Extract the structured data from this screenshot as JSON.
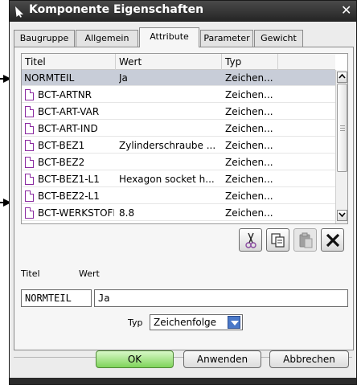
{
  "window": {
    "title": "Komponente Eigenschaften",
    "close_glyph": "✕"
  },
  "tabs": [
    {
      "label": "Baugruppe",
      "active": false
    },
    {
      "label": "Allgemein",
      "active": false
    },
    {
      "label": "Attribute",
      "active": true
    },
    {
      "label": "Parameter",
      "active": false
    },
    {
      "label": "Gewicht",
      "active": false
    }
  ],
  "table": {
    "columns": [
      "Titel",
      "Wert",
      "Typ"
    ],
    "rows": [
      {
        "titel": "NORMTEIL",
        "wert": "Ja",
        "typ": "Zeichen...",
        "selected": true,
        "icon": "none"
      },
      {
        "titel": "BCT-ARTNR",
        "wert": "",
        "typ": "Zeichen...",
        "selected": false,
        "icon": "document-icon"
      },
      {
        "titel": "BCT-ART-VAR",
        "wert": "",
        "typ": "Zeichen...",
        "selected": false,
        "icon": "document-icon"
      },
      {
        "titel": "BCT-ART-IND",
        "wert": "",
        "typ": "Zeichen...",
        "selected": false,
        "icon": "document-icon"
      },
      {
        "titel": "BCT-BEZ1",
        "wert": "Zylinderschraube ...",
        "typ": "Zeichen...",
        "selected": false,
        "icon": "document-icon"
      },
      {
        "titel": "BCT-BEZ2",
        "wert": "",
        "typ": "Zeichen...",
        "selected": false,
        "icon": "document-icon"
      },
      {
        "titel": "BCT-BEZ1-L1",
        "wert": "Hexagon socket h...",
        "typ": "Zeichen...",
        "selected": false,
        "icon": "document-icon"
      },
      {
        "titel": "BCT-BEZ2-L1",
        "wert": "",
        "typ": "Zeichen...",
        "selected": false,
        "icon": "document-icon"
      },
      {
        "titel": "BCT-WERKSTOFF",
        "wert": "8.8",
        "typ": "Zeichen...",
        "selected": false,
        "icon": "document-icon"
      }
    ]
  },
  "tools": {
    "cut": {
      "icon": "scissors-icon",
      "enabled": true
    },
    "copy": {
      "icon": "copy-icon",
      "enabled": true
    },
    "paste": {
      "icon": "paste-icon",
      "enabled": false
    },
    "delete": {
      "icon": "delete-x-icon",
      "enabled": true
    }
  },
  "edit": {
    "titel_label": "Titel",
    "wert_label": "Wert",
    "titel_value": "NORMTEIL",
    "wert_value": "Ja",
    "typ_label": "Typ",
    "typ_value": "Zeichenfolge"
  },
  "buttons": {
    "ok": "OK",
    "apply": "Anwenden",
    "cancel": "Abbrechen"
  },
  "colors": {
    "titlebar": "#2b2b2b",
    "selected_row": "#c8cdd8",
    "ok_button": "#7fd45a",
    "dropdown_accent": "#4a78c8",
    "attribute_icon": "#8a2aa0"
  }
}
